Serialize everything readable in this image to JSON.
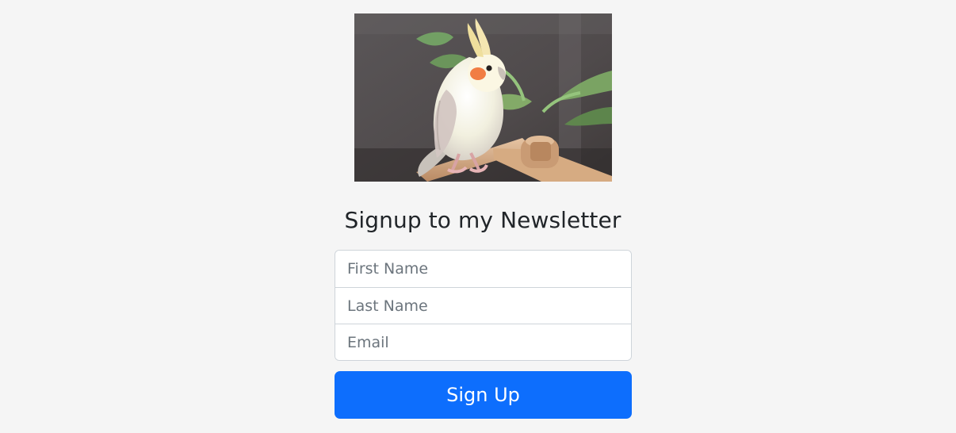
{
  "hero": {
    "image_subject": "cockatiel perched on wooden stand"
  },
  "newsletter": {
    "title": "Signup to my Newsletter",
    "fields": {
      "first_name_placeholder": "First Name",
      "first_name_value": "",
      "last_name_placeholder": "Last Name",
      "last_name_value": "",
      "email_placeholder": "Email",
      "email_value": ""
    },
    "submit_label": "Sign Up"
  },
  "colors": {
    "page_background": "#f5f5f5",
    "button_primary": "#0d6efd",
    "input_border": "#ced4da",
    "placeholder_text": "#6c757d"
  }
}
